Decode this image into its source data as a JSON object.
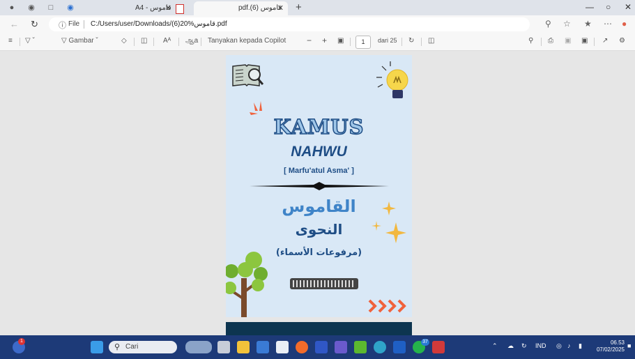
{
  "tabs": [
    {
      "label": "A4 - قاموس"
    },
    {
      "label": "pdf.(6) قاموس"
    }
  ],
  "address": {
    "file_label": "File",
    "url": "C:/Users/user/Downloads/(6)20%قاموس.pdf"
  },
  "pdf_toolbar": {
    "draw_label": "Gambar",
    "read_aloud_label": "Aᴬ",
    "translate_label": "ஆa",
    "copilot_label": "Tanyakan kepada Copilot",
    "zoom_out": "−",
    "zoom_in": "+",
    "page_current": "1",
    "page_total": "dari 25"
  },
  "document": {
    "title": "KAMUS",
    "subtitle": "NAHWU",
    "author": "[ Marfu'atul Asma' ]",
    "arabic_title": "القاموس",
    "arabic_subtitle": "النحوى",
    "arabic_note": "(مرفوعات الأسماء)",
    "colors": {
      "page_bg": "#d9e8f6",
      "navy": "#1e4d85",
      "light_blue": "#3f84c8",
      "accent_orange": "#f0623c",
      "bulb_yellow": "#f6d64b"
    }
  },
  "taskbar": {
    "search_placeholder": "Cari",
    "lang": "IND",
    "time": "06.53",
    "date": "07/02/2025",
    "weather_badge": "1",
    "whatsapp_badge": "37"
  },
  "icons": [
    "profile-icon",
    "workspaces-icon",
    "tab-actions-icon",
    "edge-icon",
    "pdf-icon",
    "close-icon",
    "new-tab-icon",
    "minimize-icon",
    "restore-icon",
    "window-close-icon",
    "back-icon",
    "refresh-icon",
    "info-icon",
    "zoom-icon",
    "favorite-icon",
    "favorites-icon",
    "more-icon",
    "copilot-icon",
    "contents-icon",
    "filter-icon",
    "draw-icon",
    "eraser-icon",
    "view-icon",
    "fit-icon",
    "rotate-icon",
    "two-page-icon",
    "search-icon",
    "print-icon",
    "save-icon",
    "save-as-icon",
    "fullscreen-icon",
    "settings-icon",
    "windows-start-icon"
  ]
}
